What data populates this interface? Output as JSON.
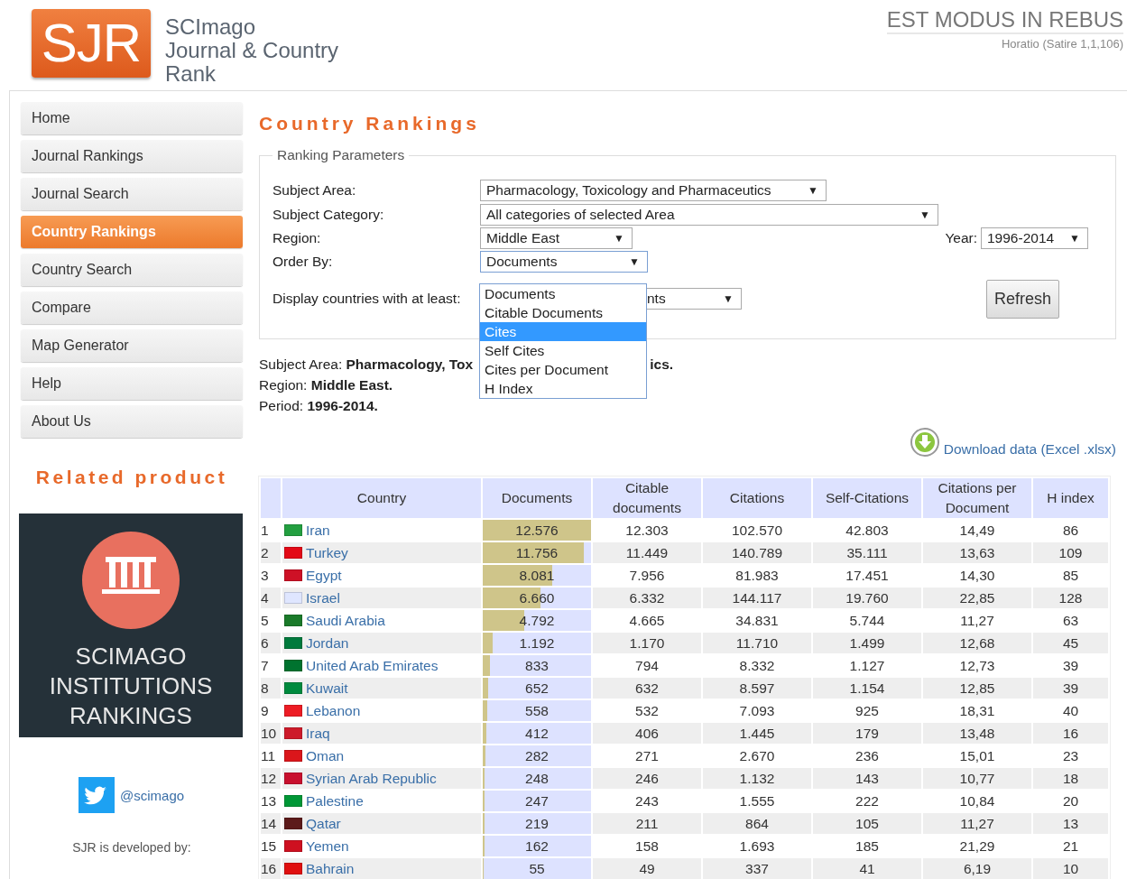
{
  "header": {
    "logo": "SJR",
    "title_lines": [
      "SCImago",
      "Journal & Country",
      "Rank"
    ],
    "motto": "EST MODUS IN REBUS",
    "motto_source": "Horatio (Satire 1,1,106)"
  },
  "sidebar": {
    "items": [
      {
        "label": "Home",
        "selected": false
      },
      {
        "label": "Journal Rankings",
        "selected": false
      },
      {
        "label": "Journal Search",
        "selected": false
      },
      {
        "label": "Country Rankings",
        "selected": true
      },
      {
        "label": "Country Search",
        "selected": false
      },
      {
        "label": "Compare",
        "selected": false
      },
      {
        "label": "Map Generator",
        "selected": false
      },
      {
        "label": "Help",
        "selected": false
      },
      {
        "label": "About Us",
        "selected": false
      }
    ],
    "related_title": "Related product",
    "banner_lines": [
      "SCIMAGO",
      "INSTITUTIONS",
      "RANKINGS"
    ],
    "twitter": "@scimago",
    "footer": "SJR is developed by:"
  },
  "page_title": "Country Rankings",
  "parameters": {
    "legend": "Ranking Parameters",
    "fields": [
      {
        "label": "Subject Area:",
        "value": "Pharmacology, Toxicology and Pharmaceutics",
        "caret": "▼"
      },
      {
        "label": "Subject Category:",
        "value": "All categories of selected Area",
        "caret": "▼"
      },
      {
        "label": "Region:",
        "value": "Middle East",
        "caret": "▼"
      },
      {
        "label": "Order By:",
        "value": "Documents",
        "caret": "▼"
      },
      {
        "label": "Display countries with at least:",
        "value": "nts",
        "caret": "▼"
      }
    ],
    "year_label": "Year:",
    "year_value": "1996-2014",
    "year_caret": "▼",
    "refresh": "Refresh",
    "order_options": [
      {
        "label": "Documents",
        "selected": false
      },
      {
        "label": "Citable Documents",
        "selected": false
      },
      {
        "label": "Cites",
        "selected": true
      },
      {
        "label": "Self Cites",
        "selected": false
      },
      {
        "label": "Cites per Document",
        "selected": false
      },
      {
        "label": "H Index",
        "selected": false
      }
    ]
  },
  "summary": [
    {
      "label": "Subject Area:",
      "value": "Pharmacology, Tox",
      "tail": "ics."
    },
    {
      "label": "Region:",
      "value": "Middle East."
    },
    {
      "label": "Period:",
      "value": "1996-2014."
    }
  ],
  "download": "Download data (Excel .xlsx)",
  "table": {
    "columns": [
      "Country",
      "Documents",
      "Citable documents",
      "Citations",
      "Self-Citations",
      "Citations per Document",
      "H index"
    ],
    "rows": [
      {
        "rank": "1",
        "country": "Iran",
        "color": "#239f40",
        "documents": "12.576",
        "level": 1,
        "citable": "12.303",
        "citations": "102.570",
        "self_citations": "42.803",
        "per_document": "14,49",
        "h_index": "86"
      },
      {
        "rank": "2",
        "country": "Turkey",
        "color": "#e30a17",
        "documents": "11.756",
        "level": 0.935,
        "citable": "11.449",
        "citations": "140.789",
        "self_citations": "35.111",
        "per_document": "13,63",
        "h_index": "109"
      },
      {
        "rank": "3",
        "country": "Egypt",
        "color": "#ce1126",
        "documents": "8.081",
        "level": 0.643,
        "citable": "7.956",
        "citations": "81.983",
        "self_citations": "17.451",
        "per_document": "14,30",
        "h_index": "85"
      },
      {
        "rank": "4",
        "country": "Israel",
        "color": "#dfe6ff",
        "documents": "6.660",
        "level": 0.53,
        "citable": "6.332",
        "citations": "144.117",
        "self_citations": "19.760",
        "per_document": "22,85",
        "h_index": "128"
      },
      {
        "rank": "5",
        "country": "Saudi Arabia",
        "color": "#1a7a2a",
        "documents": "4.792",
        "level": 0.381,
        "citable": "4.665",
        "citations": "34.831",
        "self_citations": "5.744",
        "per_document": "11,27",
        "h_index": "63"
      },
      {
        "rank": "6",
        "country": "Jordan",
        "color": "#007a3d",
        "documents": "1.192",
        "level": 0.095,
        "citable": "1.170",
        "citations": "11.710",
        "self_citations": "1.499",
        "per_document": "12,68",
        "h_index": "45"
      },
      {
        "rank": "7",
        "country": "United Arab Emirates",
        "color": "#00732f",
        "documents": "833",
        "level": 0.066,
        "citable": "794",
        "citations": "8.332",
        "self_citations": "1.127",
        "per_document": "12,73",
        "h_index": "39"
      },
      {
        "rank": "8",
        "country": "Kuwait",
        "color": "#008a3e",
        "documents": "652",
        "level": 0.052,
        "citable": "632",
        "citations": "8.597",
        "self_citations": "1.154",
        "per_document": "12,85",
        "h_index": "39"
      },
      {
        "rank": "9",
        "country": "Lebanon",
        "color": "#ed1c24",
        "documents": "558",
        "level": 0.044,
        "citable": "532",
        "citations": "7.093",
        "self_citations": "925",
        "per_document": "18,31",
        "h_index": "40"
      },
      {
        "rank": "10",
        "country": "Iraq",
        "color": "#cd1a2a",
        "documents": "412",
        "level": 0.033,
        "citable": "406",
        "citations": "1.445",
        "self_citations": "179",
        "per_document": "13,48",
        "h_index": "16"
      },
      {
        "rank": "11",
        "country": "Oman",
        "color": "#db161b",
        "documents": "282",
        "level": 0.022,
        "citable": "271",
        "citations": "2.670",
        "self_citations": "236",
        "per_document": "15,01",
        "h_index": "23"
      },
      {
        "rank": "12",
        "country": "Syrian Arab Republic",
        "color": "#c8102e",
        "documents": "248",
        "level": 0.02,
        "citable": "246",
        "citations": "1.132",
        "self_citations": "143",
        "per_document": "10,77",
        "h_index": "18"
      },
      {
        "rank": "13",
        "country": "Palestine",
        "color": "#009736",
        "documents": "247",
        "level": 0.02,
        "citable": "243",
        "citations": "1.555",
        "self_citations": "222",
        "per_document": "10,84",
        "h_index": "20"
      },
      {
        "rank": "14",
        "country": "Qatar",
        "color": "#5c1a1a",
        "documents": "219",
        "level": 0.017,
        "citable": "211",
        "citations": "864",
        "self_citations": "105",
        "per_document": "11,27",
        "h_index": "13"
      },
      {
        "rank": "15",
        "country": "Yemen",
        "color": "#ce1020",
        "documents": "162",
        "level": 0.013,
        "citable": "158",
        "citations": "1.693",
        "self_citations": "185",
        "per_document": "21,29",
        "h_index": "21"
      },
      {
        "rank": "16",
        "country": "Bahrain",
        "color": "#e01010",
        "documents": "55",
        "level": 0.004,
        "citable": "49",
        "citations": "337",
        "self_citations": "41",
        "per_document": "6,19",
        "h_index": "10"
      }
    ]
  }
}
